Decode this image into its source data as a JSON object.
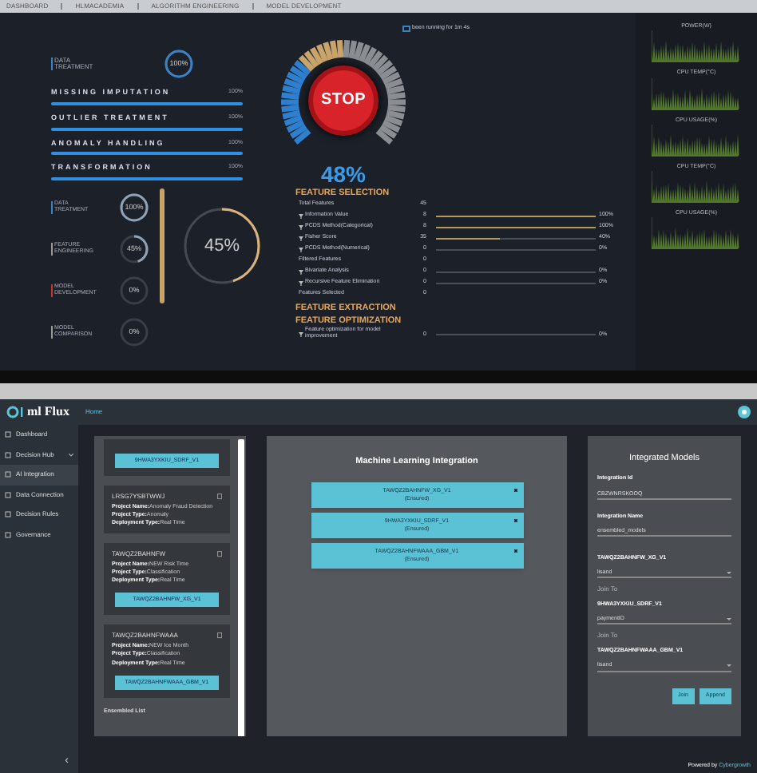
{
  "dashboard": {
    "breadcrumbs": [
      "DASHBOARD",
      "HLMACADEMIA",
      "ALGORITHM ENGINEERING",
      "MODEL DEVELOPMENT"
    ],
    "run_status": "been running for 1m 4s",
    "data_treatment": {
      "label": "DATA TREATMENT",
      "value": "100%",
      "level": 1
    },
    "steps": [
      {
        "label": "MISSING IMPUTATION",
        "value": "100%",
        "level": 1
      },
      {
        "label": "OUTLIER TREATMENT",
        "value": "100%",
        "level": 1
      },
      {
        "label": "ANOMALY HANDLING",
        "value": "100%",
        "level": 1
      },
      {
        "label": "TRANSFORMATION",
        "value": "100%",
        "level": 1
      }
    ],
    "gauge": {
      "button": "STOP",
      "value": "48%",
      "level": 0.48
    },
    "stages": [
      {
        "label": "DATA TREATMENT",
        "value": "100%",
        "level": 1,
        "color": "#3b82c4"
      },
      {
        "label": "FEATURE ENGINEERING",
        "value": "45%",
        "level": 0.45,
        "color": "#9a9a9a"
      },
      {
        "label": "MODEL DEVELOPMENT",
        "value": "0%",
        "level": 0,
        "color": "#c0392b"
      },
      {
        "label": "MODEL COMPARISON",
        "value": "0%",
        "level": 0,
        "color": "#9a9a9a"
      }
    ],
    "stage_ring": {
      "value": "45%",
      "level": 0.45
    },
    "feature_sections": [
      {
        "title": "FEATURE SELECTION",
        "rows": [
          {
            "kind": "plain",
            "label": "Total Features",
            "count": "45"
          },
          {
            "kind": "bar",
            "label": "Information Value",
            "count": "8",
            "level": 1,
            "reading": "100%"
          },
          {
            "kind": "bar",
            "label": "PCDS Method(Categorical)",
            "count": "8",
            "level": 1,
            "reading": "100%"
          },
          {
            "kind": "bar",
            "label": "Fisher Score",
            "count": "35",
            "level": 0.4,
            "reading": "40%"
          },
          {
            "kind": "bar",
            "label": "PCDS Method(Numerical)",
            "count": "0",
            "level": 0,
            "reading": "0%"
          },
          {
            "kind": "plain",
            "label": "Filtered Features",
            "count": "0"
          },
          {
            "kind": "bar",
            "label": "Bivariate Analysis",
            "count": "0",
            "level": 0,
            "reading": "0%"
          },
          {
            "kind": "bar",
            "label": "Recursive Feature Elimination",
            "count": "0",
            "level": 0,
            "reading": "0%"
          },
          {
            "kind": "plain",
            "label": "Features Selected",
            "count": "0"
          }
        ]
      },
      {
        "title": "FEATURE EXTRACTION"
      },
      {
        "title": "FEATURE OPTIMIZATION",
        "rows": [
          {
            "kind": "bar",
            "label": "Feature optimization for model improvement",
            "count": "0",
            "level": 0,
            "reading": "0%"
          }
        ]
      }
    ],
    "monitors": [
      {
        "title": "POWER(W)"
      },
      {
        "title": "CPU TEMP(°C)"
      },
      {
        "title": "CPU USAGE(%)"
      },
      {
        "title": "CPU TEMP(°C)"
      },
      {
        "title": "CPU USAGE(%)"
      }
    ]
  },
  "app": {
    "logo": "ml Flux",
    "nav_link": "Home",
    "sidebar": [
      {
        "label": "Dashboard",
        "selected": false,
        "expandable": false
      },
      {
        "label": "Decision Hub",
        "selected": false,
        "expandable": true
      },
      {
        "label": "AI Integration",
        "selected": true,
        "expandable": false
      },
      {
        "label": "Data Connection",
        "selected": false,
        "expandable": false
      },
      {
        "label": "Decision Rules",
        "selected": false,
        "expandable": false
      },
      {
        "label": "Governance",
        "selected": false,
        "expandable": false
      }
    ],
    "collapse": "‹",
    "model_cards": [
      {
        "button": "9HWA3YXKIU_SDRF_V1"
      },
      {
        "id": "LRSG7YSBTWWJ",
        "details": [
          {
            "key": "Project Name:",
            "value": "Anomaly Fraud Detection"
          },
          {
            "key": "Project Type:",
            "value": "Anomaly"
          },
          {
            "key": "Deployment Type:",
            "value": "Real Time"
          }
        ]
      },
      {
        "id": "TAWQZ2BAHNFW",
        "details": [
          {
            "key": "Project Name:",
            "value": "NEW Risk Time"
          },
          {
            "key": "Project Type:",
            "value": "Classification"
          },
          {
            "key": "Deployment Type:",
            "value": "Real Time"
          }
        ],
        "button": "TAWQZ2BAHNFW_XG_V1"
      },
      {
        "id": "TAWQZ2BAHNFWAAA",
        "details": [
          {
            "key": "Project Name:",
            "value": "NEW Ice Month"
          },
          {
            "key": "Project Type:",
            "value": "Classification"
          },
          {
            "key": "Deployment Type:",
            "value": "Real Time"
          }
        ],
        "button": "TAWQZ2BAHNFWAAA_GBM_V1"
      }
    ],
    "ensembled_label": "Ensembled List",
    "integration": {
      "title": "Machine Learning Integration",
      "items": [
        {
          "name": "TAWQZ2BAHNFW_XG_V1",
          "status": "(Ensured)"
        },
        {
          "name": "9HWA3YXKIU_SDRF_V1",
          "status": "(Ensured)"
        },
        {
          "name": "TAWQZ2BAHNFWAAA_GBM_V1",
          "status": "(Ensured)"
        }
      ]
    },
    "integrated": {
      "title": "Integrated Models",
      "fields": [
        {
          "label": "Integration Id",
          "value": "CBZWNRSKOOQ"
        },
        {
          "label": "Integration Name",
          "value": "ensembled_models"
        }
      ],
      "models": [
        {
          "name": "TAWQZ2BAHNFW_XG_V1",
          "select": "lisand",
          "join": "Join To"
        },
        {
          "name": "9HWA3YXKIU_SDRF_V1",
          "select": "paymentID",
          "join": "Join To"
        },
        {
          "name": "TAWQZ2BAHNFWAAA_GBM_V1",
          "select": "lisand"
        }
      ],
      "buttons": [
        "Join",
        "Append"
      ]
    },
    "footer": {
      "text": "Powered by",
      "brand": "Cybergrowth"
    }
  }
}
